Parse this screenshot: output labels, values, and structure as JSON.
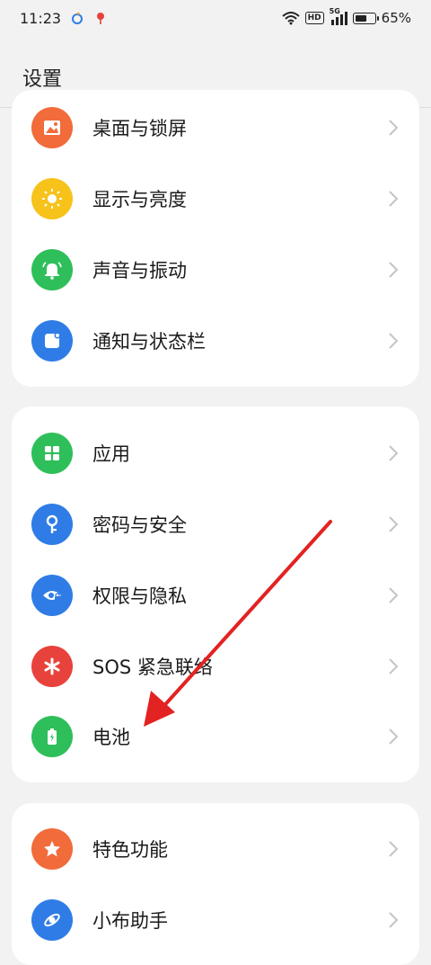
{
  "status": {
    "time": "11:23",
    "network": "5G",
    "battery_percent": "65%",
    "battery_level": 0.65
  },
  "header": {
    "title": "设置"
  },
  "groups": [
    {
      "items": [
        {
          "label": "桌面与锁屏",
          "icon": "wallpaper-icon",
          "color": "#f26b3a"
        },
        {
          "label": "显示与亮度",
          "icon": "brightness-icon",
          "color": "#f7c21a"
        },
        {
          "label": "声音与振动",
          "icon": "bell-icon",
          "color": "#2fbf5a"
        },
        {
          "label": "通知与状态栏",
          "icon": "notification-icon",
          "color": "#2f7ce6"
        }
      ]
    },
    {
      "items": [
        {
          "label": "应用",
          "icon": "apps-icon",
          "color": "#2fbf5a"
        },
        {
          "label": "密码与安全",
          "icon": "key-icon",
          "color": "#2f7ce6"
        },
        {
          "label": "权限与隐私",
          "icon": "privacy-eye-icon",
          "color": "#2f7ce6"
        },
        {
          "label": "SOS 紧急联络",
          "icon": "sos-asterisk-icon",
          "color": "#e8423c"
        },
        {
          "label": "电池",
          "icon": "battery-icon",
          "color": "#2fbf5a"
        }
      ]
    },
    {
      "items": [
        {
          "label": "特色功能",
          "icon": "star-icon",
          "color": "#f26b3a"
        },
        {
          "label": "小布助手",
          "icon": "assistant-icon",
          "color": "#2f7ce6"
        }
      ]
    }
  ]
}
